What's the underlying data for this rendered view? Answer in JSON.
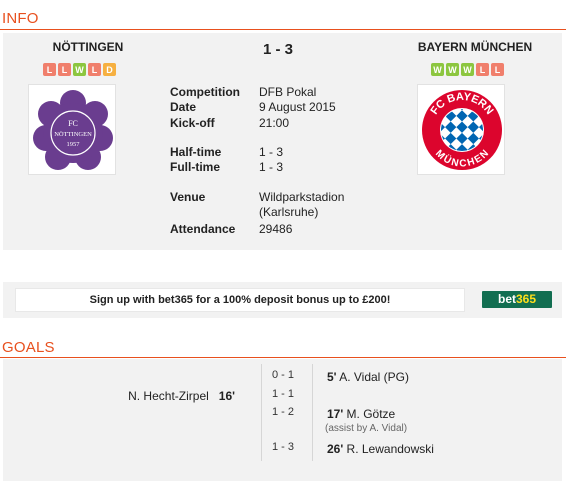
{
  "info": {
    "section_title": "INFO",
    "home_team": {
      "name": "NÖTTINGEN",
      "form": [
        "L",
        "L",
        "W",
        "L",
        "D"
      ],
      "crest_text_top": "FC",
      "crest_text_mid": "NÖTTINGEN",
      "crest_text_year": "1957"
    },
    "away_team": {
      "name": "BAYERN MÜNCHEN",
      "form": [
        "W",
        "W",
        "W",
        "L",
        "L"
      ],
      "crest_text_top": "FC BAYERN",
      "crest_text_bottom": "MÜNCHEN"
    },
    "score": "1 - 3",
    "details": {
      "competition_label": "Competition",
      "competition_value": "DFB Pokal",
      "date_label": "Date",
      "date_value": "9 August 2015",
      "kickoff_label": "Kick-off",
      "kickoff_value": "21:00",
      "halftime_label": "Half-time",
      "halftime_value": "1 - 3",
      "fulltime_label": "Full-time",
      "fulltime_value": "1 - 3",
      "venue_label": "Venue",
      "venue_value_line1": "Wildparkstadion",
      "venue_value_line2": "(Karlsruhe)",
      "attendance_label": "Attendance",
      "attendance_value": "29486"
    }
  },
  "promo": {
    "text": "Sign up with bet365 for a 100% deposit bonus up to £200!",
    "logo_part1": "bet",
    "logo_part2": "365"
  },
  "goals": {
    "section_title": "GOALS",
    "rows": [
      {
        "home_scorer": "",
        "home_minute": "",
        "score": "0 - 1",
        "away_minute": "5'",
        "away_scorer": "A. Vidal (PG)",
        "assist": ""
      },
      {
        "home_scorer": "N. Hecht-Zirpel",
        "home_minute": "16'",
        "score": "1 - 1",
        "away_minute": "",
        "away_scorer": "",
        "assist": ""
      },
      {
        "home_scorer": "",
        "home_minute": "",
        "score": "1 - 2",
        "away_minute": "17'",
        "away_scorer": "M. Götze",
        "assist": "(assist by A. Vidal)"
      },
      {
        "home_scorer": "",
        "home_minute": "",
        "score": "1 - 3",
        "away_minute": "26'",
        "away_scorer": "R. Lewandowski",
        "assist": ""
      }
    ]
  },
  "colors": {
    "accent": "#e8501e",
    "form_win": "#8cc63f",
    "form_loss": "#f07f6c",
    "form_draw": "#f6b041",
    "home_crest": "#6a3d8f",
    "away_crest_red": "#dc052d",
    "away_crest_blue": "#0066b2"
  }
}
